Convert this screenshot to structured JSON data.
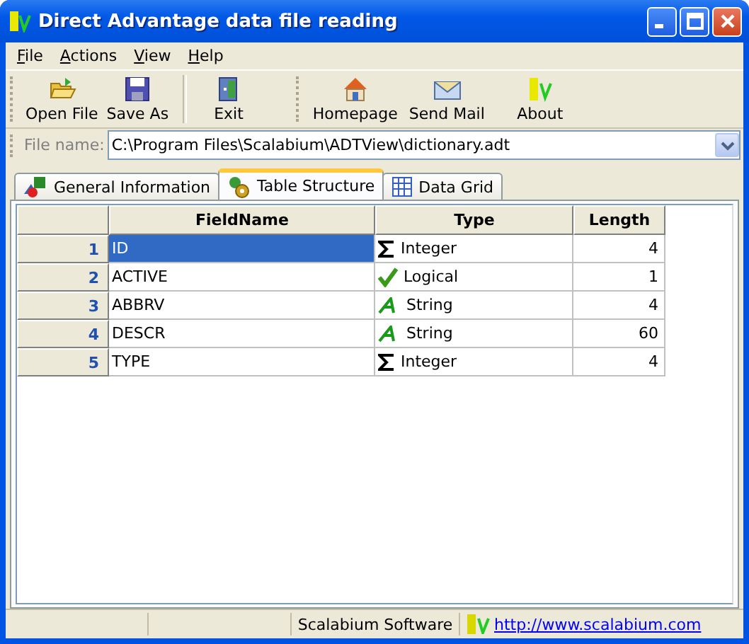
{
  "window": {
    "title": "Direct Advantage data file reading"
  },
  "menu": [
    "File",
    "Actions",
    "View",
    "Help"
  ],
  "toolbar_groups": [
    {
      "buttons": [
        {
          "label": "Open File",
          "kind": "open"
        },
        {
          "label": "Save As",
          "kind": "save"
        }
      ]
    },
    {
      "buttons": [
        {
          "label": "Exit",
          "kind": "exit"
        }
      ]
    },
    {
      "buttons": [
        {
          "label": "Homepage",
          "kind": "home"
        },
        {
          "label": "Send Mail",
          "kind": "mail"
        },
        {
          "label": "About",
          "kind": "about"
        }
      ]
    }
  ],
  "file_name": {
    "label": "File name:",
    "value": "C:\\Program Files\\Scalabium\\ADTView\\dictionary.adt"
  },
  "tabs": [
    {
      "label": "General Information",
      "kind": "info",
      "selected": false
    },
    {
      "label": "Table Structure",
      "kind": "structure",
      "selected": true
    },
    {
      "label": "Data Grid",
      "kind": "grid",
      "selected": false
    }
  ],
  "table": {
    "columns": [
      "FieldName",
      "Type",
      "Length"
    ],
    "rows": [
      {
        "number": "1",
        "name": "ID",
        "type": "Integer",
        "kind": "sum",
        "length": "4",
        "selected": true
      },
      {
        "number": "2",
        "name": "ACTIVE",
        "type": "Logical",
        "kind": "check",
        "length": "1",
        "selected": false
      },
      {
        "number": "3",
        "name": "ABBRV",
        "type": "String",
        "kind": "letter",
        "length": "4",
        "selected": false
      },
      {
        "number": "4",
        "name": "DESCR",
        "type": "String",
        "kind": "letter",
        "length": "60",
        "selected": false
      },
      {
        "number": "5",
        "name": "TYPE",
        "type": "Integer",
        "kind": "sum",
        "length": "4",
        "selected": false
      }
    ]
  },
  "status_bar": {
    "company": "Scalabium Software",
    "link": "http://www.scalabium.com"
  }
}
